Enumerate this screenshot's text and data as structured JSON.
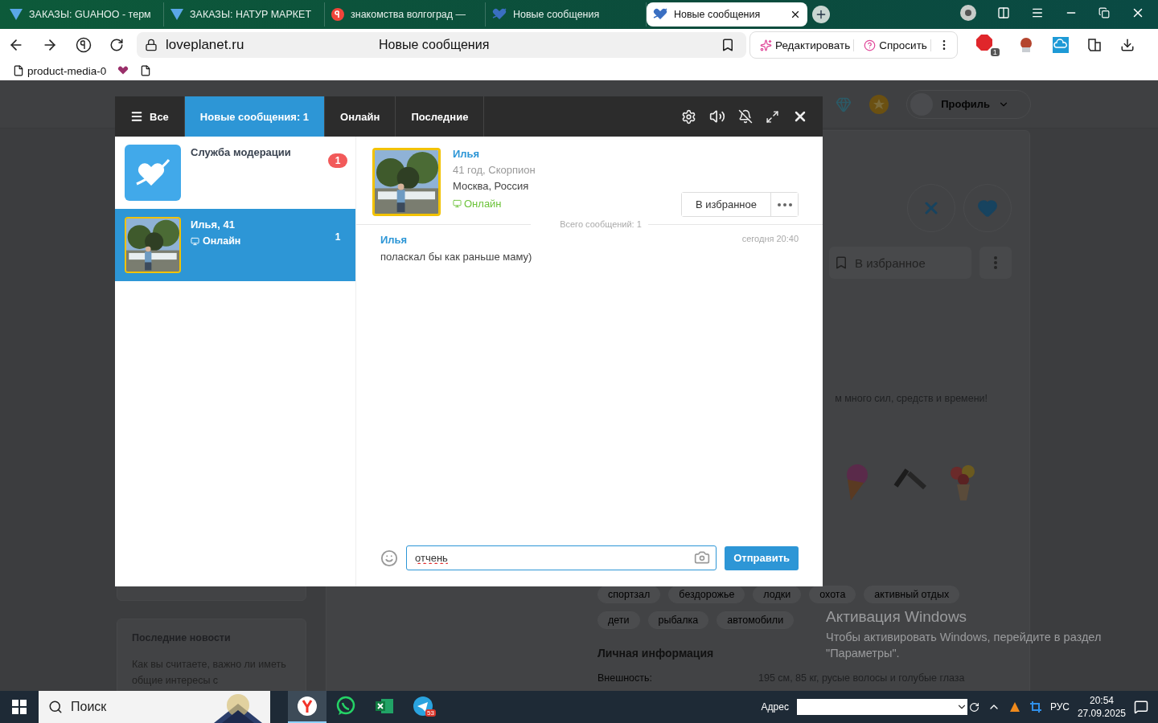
{
  "browser": {
    "tabs": [
      {
        "kind": "mail",
        "title": "ЗАКАЗЫ: GUAHOO - терм",
        "selected": false
      },
      {
        "kind": "mail",
        "title": "ЗАКАЗЫ: НАТУР МАРКЕТ",
        "selected": false
      },
      {
        "kind": "yandex",
        "title": "знакомства волгоград —",
        "selected": false
      },
      {
        "kind": "planet",
        "title": "Новые сообщения",
        "selected": false
      },
      {
        "kind": "planet",
        "title": "Новые сообщения",
        "selected": true
      }
    ],
    "address": {
      "host": "loveplanet.ru",
      "title": "Новые сообщения"
    },
    "actions": [
      "Редактировать",
      "Спросить"
    ],
    "extension_badge": "1",
    "bookmarks": [
      {
        "kind": "page",
        "label": "product-media-0"
      },
      {
        "kind": "planet"
      },
      {
        "kind": "page"
      }
    ]
  },
  "site": {
    "profile_label": "Профиль",
    "favorite_button": "В избранное",
    "text_line": "м много сил, средств и времени!",
    "tags": [
      "спортзал",
      "бездорожье",
      "лодки",
      "охота",
      "активный отдых",
      "дети",
      "рыбалка",
      "автомобили"
    ],
    "info_heading": "Личная информация",
    "info_rows": [
      {
        "label": "Внешность:",
        "value": "195 см, 85 кг, русые волосы и голубые глаза"
      }
    ],
    "news": {
      "title": "Последние новости",
      "text": "Как вы считаете, важно ли иметь общие интересы с"
    }
  },
  "chat": {
    "tabs": [
      {
        "kind": "menu",
        "label": "Все",
        "selected": false
      },
      {
        "kind": "plain",
        "label": "Новые сообщения: 1",
        "selected": true
      },
      {
        "kind": "plain",
        "label": "Онлайн",
        "selected": false
      },
      {
        "kind": "plain",
        "label": "Последние",
        "selected": false
      }
    ],
    "contacts": [
      {
        "kind": "service",
        "name": "Служба модерации",
        "badge": "1",
        "selected": false
      },
      {
        "name": "Илья, 41",
        "status": "Онлайн",
        "badge": "1",
        "selected": true
      }
    ],
    "profile": {
      "name": "Илья",
      "details": "41 год, Скорпион",
      "city": "Москва, Россия",
      "status": "Онлайн",
      "favorite_button": "В избранное"
    },
    "total_label": "Всего сообщений: 1",
    "messages": [
      {
        "author": "Илья",
        "time": "сегодня 20:40",
        "text": "поласкал бы как раньше маму)"
      }
    ],
    "input": {
      "value": "отчень",
      "misspelled": true
    },
    "send_button": "Отправить"
  },
  "activation_notice": {
    "title": "Активация Windows",
    "text": "Чтобы активировать Windows, перейдите в раздел \"Параметры\"."
  },
  "taskbar": {
    "search_placeholder": "Поиск",
    "apps": [
      {
        "kind": "yandex",
        "selected": true
      },
      {
        "kind": "whatsapp",
        "selected": false
      },
      {
        "kind": "excel",
        "selected": false
      },
      {
        "kind": "telegram",
        "selected": false,
        "badge": "53"
      }
    ],
    "address_label": "Адрес",
    "language": "РУС",
    "time": "20:54",
    "date": "27.09.2025"
  }
}
